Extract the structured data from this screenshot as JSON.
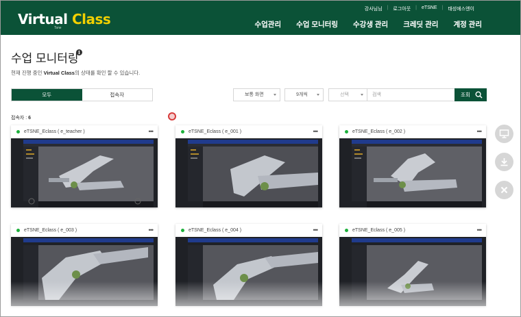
{
  "header": {
    "logo_main": "Virtual ",
    "logo_accent": "Class",
    "logo_sub": "Tsne",
    "util_links": [
      "강사님님",
      "로그아웃",
      "eTSNE",
      "태성에스엔이"
    ],
    "nav": [
      "수업관리",
      "수업 모니터링",
      "수강생 관리",
      "크레딧 관리",
      "계정 관리"
    ]
  },
  "page": {
    "title": "수업 모니터링",
    "desc_prefix": "현재 진행 중인 ",
    "desc_bold": "Virtual Class",
    "desc_suffix": "의 상태를 확인 할 수 있습니다."
  },
  "filters": {
    "seg_all": "모두",
    "seg_connected": "접속자",
    "view_select": "보통 화면",
    "count_select": "9개씩",
    "field_select": "선택",
    "search_placeholder": "검색",
    "search_button": "조회"
  },
  "status": {
    "count_label": "접속자 : ",
    "count_value": "6"
  },
  "cards": [
    {
      "title": "eTSNE_Eclass ( e_teacher )"
    },
    {
      "title": "eTSNE_Eclass ( e_001 )"
    },
    {
      "title": "eTSNE_Eclass ( e_002 )"
    },
    {
      "title": "eTSNE_Eclass ( e_003 )"
    },
    {
      "title": "eTSNE_Eclass ( e_004 )"
    },
    {
      "title": "eTSNE_Eclass ( e_005 )"
    }
  ],
  "card_more": "•••",
  "colors": {
    "brand": "#0b5237",
    "accent": "#f2d000",
    "online": "#1db03b"
  },
  "icons": {
    "side": [
      "monitor-icon",
      "download-icon",
      "close-icon"
    ]
  }
}
